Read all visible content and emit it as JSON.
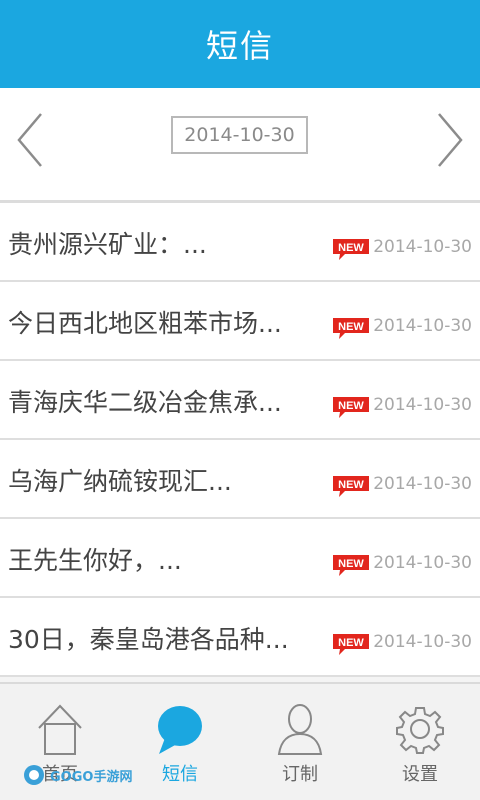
{
  "header": {
    "title": "短信"
  },
  "date_nav": {
    "current_date": "2014-10-30"
  },
  "messages": [
    {
      "text": "贵州源兴矿业：...",
      "badge": "NEW",
      "date": "2014-10-30"
    },
    {
      "text": "今日西北地区粗苯市场...",
      "badge": "NEW",
      "date": "2014-10-30"
    },
    {
      "text": "青海庆华二级冶金焦承...",
      "badge": "NEW",
      "date": "2014-10-30"
    },
    {
      "text": "乌海广纳硫铵现汇...",
      "badge": "NEW",
      "date": "2014-10-30"
    },
    {
      "text": "王先生你好，...",
      "badge": "NEW",
      "date": "2014-10-30"
    },
    {
      "text": "30日，秦皇岛港各品种...",
      "badge": "NEW",
      "date": "2014-10-30"
    }
  ],
  "tabs": [
    {
      "label": "首页",
      "icon": "home-icon"
    },
    {
      "label": "短信",
      "icon": "chat-bubble-icon"
    },
    {
      "label": "订制",
      "icon": "person-icon"
    },
    {
      "label": "设置",
      "icon": "gear-icon"
    }
  ],
  "active_tab": 1,
  "watermark": {
    "text": "GOGO手游网"
  },
  "colors": {
    "primary": "#1ba7e0",
    "badge_red": "#e2261d",
    "text": "#444444",
    "muted": "#a8a8a8"
  }
}
